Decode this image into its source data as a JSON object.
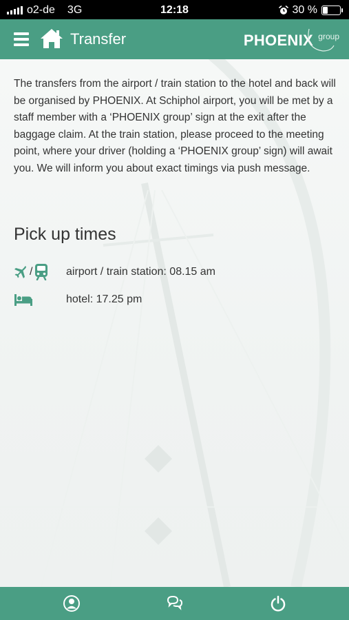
{
  "status_bar": {
    "carrier": "o2-de",
    "network": "3G",
    "time": "12:18",
    "battery_percent": "30 %",
    "battery_level": 0.3,
    "icons": [
      "signal-icon",
      "alarm-icon",
      "battery-icon"
    ]
  },
  "header": {
    "title": "Transfer",
    "brand": "PHOENIX",
    "brand_sub": "group",
    "color": "#4a9e84",
    "icons": [
      "menu-icon",
      "home-icon"
    ]
  },
  "main": {
    "intro": "The transfers from the airport / train station to the hotel and back will be organised by PHOENIX. At Schiphol airport, you will be met by a staff member with a ‘PHOENIX group’ sign at the exit after the baggage claim. At the train station, please proceed to the meeting point, where your driver (holding a ‘PHOENIX group’ sign) will await you. We will inform you about exact timings via push message.",
    "section_title": "Pick up times",
    "pickup_times": [
      {
        "icons": [
          "airplane-icon",
          "train-icon"
        ],
        "separator": "/",
        "text": "airport / train station: 08.15 am"
      },
      {
        "icons": [
          "bed-icon"
        ],
        "text": "hotel: 17.25 pm"
      }
    ],
    "icon_color": "#4a9e84"
  },
  "bottom_nav": {
    "items": [
      {
        "icon": "profile-icon"
      },
      {
        "icon": "chat-icon"
      },
      {
        "icon": "power-icon"
      }
    ]
  }
}
